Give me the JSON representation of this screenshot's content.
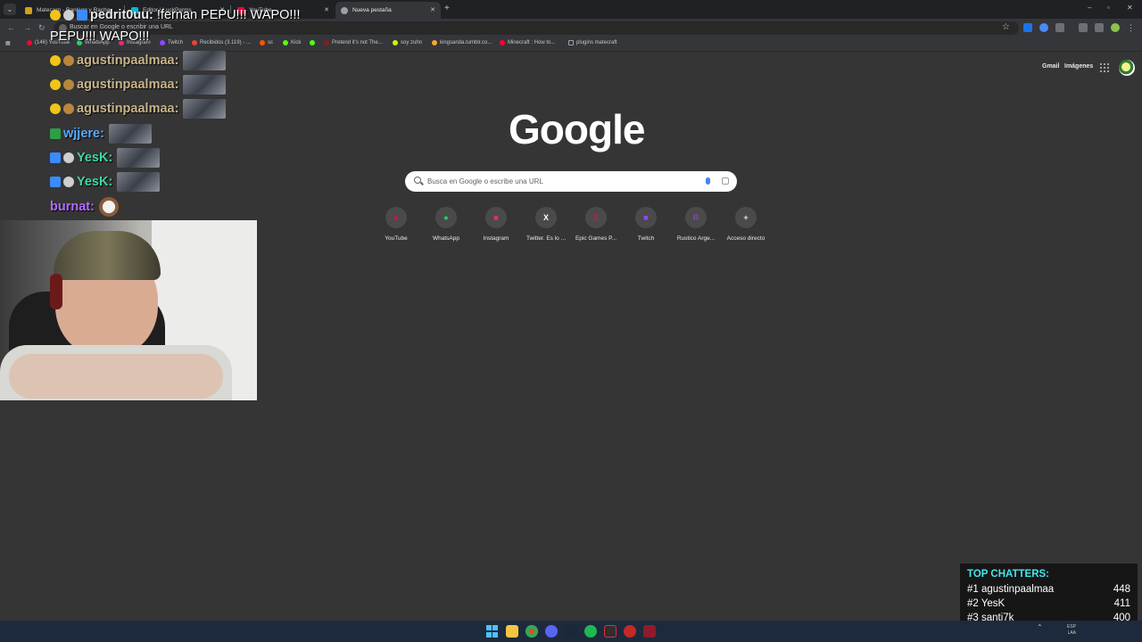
{
  "browser": {
    "tabs": [
      {
        "label": "Matecarp - Ranking y Racha",
        "active": false
      },
      {
        "label": "Editor | LuckPerms",
        "active": false
      },
      {
        "label": "YouTube",
        "active": false
      },
      {
        "label": "Nueva pestaña",
        "active": true
      }
    ],
    "omnibox_placeholder": "Buscar en Google o escribir una URL",
    "bookmarks": [
      {
        "label": "(146) YouTube",
        "color": "#ff0033"
      },
      {
        "label": "WhatsApp",
        "color": "#25d366"
      },
      {
        "label": "Instagram",
        "color": "#e1306c"
      },
      {
        "label": "Twitch",
        "color": "#9146ff"
      },
      {
        "label": "Recibidos (3.119) - ...",
        "color": "#ea4335"
      },
      {
        "label": "sc",
        "color": "#ff5500"
      },
      {
        "label": "Kick",
        "color": "#53fc18"
      },
      {
        "label": "",
        "color": "#53fc18"
      },
      {
        "label": "Pretend it's not The...",
        "color": "#8d1c1c"
      },
      {
        "label": "soy zuhn",
        "color": "#c6ff00"
      },
      {
        "label": "kingsanda.tumblr.co...",
        "color": "#f9a825"
      },
      {
        "label": "Minecraft : How to...",
        "color": "#ff0033"
      },
      {
        "label": "plugins matecraft",
        "color": "#9aa0a6"
      }
    ]
  },
  "ntp": {
    "gmail": "Gmail",
    "images": "Imágenes",
    "logo": "Google",
    "search_placeholder": "Busca en Google o escribe una URL",
    "shortcuts": [
      {
        "label": "YouTube",
        "glyph": "▶",
        "color": "#ff0033"
      },
      {
        "label": "WhatsApp",
        "glyph": "✆",
        "color": "#25d366"
      },
      {
        "label": "Instagram",
        "glyph": "◎",
        "color": "#e1306c"
      },
      {
        "label": "Twitter. Es lo ...",
        "glyph": "X",
        "color": "#000000"
      },
      {
        "label": "Epic Games P...",
        "glyph": "E",
        "color": "#c2185b"
      },
      {
        "label": "Twitch",
        "glyph": "▣",
        "color": "#9146ff"
      },
      {
        "label": "Rustico Arge...",
        "glyph": "R",
        "color": "#8e44ad"
      },
      {
        "label": "Acceso directo",
        "glyph": "+",
        "color": "#4a4a4a"
      }
    ]
  },
  "chat": [
    {
      "user": "pedrit0uu:",
      "color": "#ffffff",
      "message": "!fernan PEPU!!! WAPO!!!"
    },
    {
      "user": "",
      "color": "#ffffff",
      "message": "PEPU!!! WAPO!!!"
    },
    {
      "user": "agustinpaalmaa:",
      "color": "#c9b48a",
      "message": ""
    },
    {
      "user": "agustinpaalmaa:",
      "color": "#c9b48a",
      "message": ""
    },
    {
      "user": "agustinpaalmaa:",
      "color": "#c9b48a",
      "message": ""
    },
    {
      "user": "wjjere:",
      "color": "#5aa9ff",
      "message": ""
    },
    {
      "user": "YesK:",
      "color": "#3fd9a0",
      "message": ""
    },
    {
      "user": "YesK:",
      "color": "#3fd9a0",
      "message": ""
    },
    {
      "user": "burnat:",
      "color": "#b36bff",
      "message": ""
    }
  ],
  "top_chatters": {
    "title": "TOP CHATTERS:",
    "rows": [
      {
        "rank": "#1",
        "name": "agustinpaalmaa",
        "count": "448"
      },
      {
        "rank": "#2",
        "name": "YesK",
        "count": "411"
      },
      {
        "rank": "#3",
        "name": "santi7k",
        "count": "400"
      }
    ]
  },
  "taskbar": {
    "lang": "ESP",
    "region": "LAA"
  }
}
